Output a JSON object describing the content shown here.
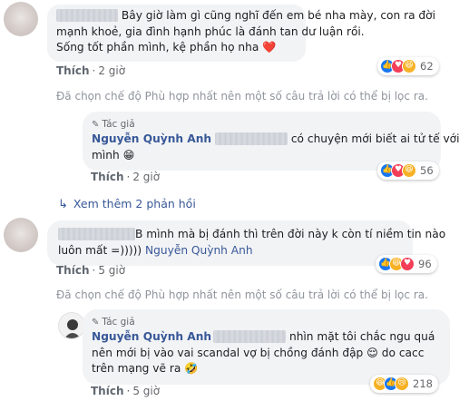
{
  "comments": [
    {
      "lines": [
        "Bây giờ làm gì cũng nghĩ đến em bé nha mày, con ra đời",
        "mạnh khoẻ, gia đình hạnh phúc là đánh tan dư luận rồi.",
        "Sống tốt phần mình, kệ phần họ nha"
      ],
      "heart": "❤️",
      "like_label": "Thích",
      "time": "2 giờ",
      "reaction_count": "62",
      "filter_note": "Đã chọn chế độ Phù hợp nhất nên một số câu trả lời có thể bị lọc ra."
    },
    {
      "badge": "Tác giả",
      "author": "Nguyễn Quỳnh Anh",
      "line1_after": "có chuyện mới biết ai tử tế với",
      "line2": "mình",
      "emoji": "😁",
      "like_label": "Thích",
      "time": "2 giờ",
      "reaction_count": "56"
    },
    {
      "more_replies": "Xem thêm 2 phản hồi"
    },
    {
      "line1_after": "B mình mà bị đánh thì trên đời này k còn tí niềm tin nào",
      "line2": "luôn mất =)))))",
      "mention": "Nguyễn Quỳnh Anh",
      "like_label": "Thích",
      "time": "5 giờ",
      "reaction_count": "96",
      "filter_note": "Đã chọn chế độ Phù hợp nhất nên một số câu trả lời có thể bị lọc ra."
    },
    {
      "badge": "Tác giả",
      "author": "Nguyễn Quỳnh Anh",
      "line1_after": "nhìn mặt tôi chắc ngu quá",
      "line2_a": "nên mới bị vào vai scandal vợ bị chồng đánh đập",
      "emoji_relieved": "😌",
      "line2_b": "do cacc",
      "line3": "trên mạng vẽ ra",
      "emoji_rofl": "🤣",
      "like_label": "Thích",
      "time": "5 giờ",
      "reaction_count": "218"
    }
  ],
  "icons": {
    "like": "thumbs-up-icon",
    "love": "heart-icon",
    "haha": "laughing-face-icon",
    "reply": "reply-arrow-icon",
    "author": "pen-icon"
  },
  "colors": {
    "link": "#385898",
    "bubble": "#f2f3f5",
    "meta": "#65676b",
    "like_blue": "#1877f2",
    "love_red": "#f33e58"
  }
}
